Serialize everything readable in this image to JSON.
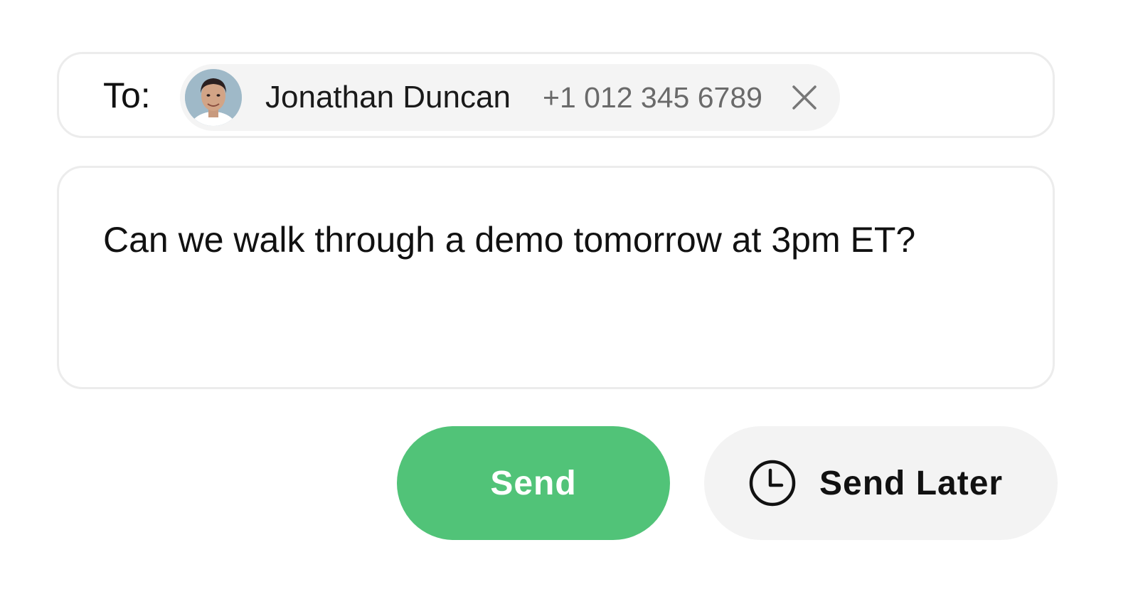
{
  "recipient_field": {
    "label": "To:",
    "recipient": {
      "name": "Jonathan Duncan",
      "phone": "+1 012 345 6789",
      "avatar_icon": "person-avatar",
      "remove_icon": "close-icon"
    }
  },
  "message": {
    "text": "Can we walk through a demo tomorrow at 3pm ET?"
  },
  "actions": {
    "send_label": "Send",
    "send_later_label": "Send Later",
    "send_later_icon": "clock-icon"
  },
  "colors": {
    "send_button": "#51c378",
    "send_later_button": "#f3f3f3",
    "chip_background": "#f4f4f4",
    "border": "#ececec"
  }
}
